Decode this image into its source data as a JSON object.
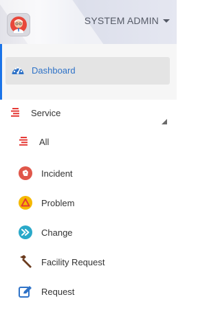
{
  "header": {
    "user_name": "SYSTEM ADMIN"
  },
  "nav": {
    "dashboard": "Dashboard",
    "service": "Service",
    "all": "All",
    "incident": "Incident",
    "problem": "Problem",
    "change": "Change",
    "facility_request": "Facility Request",
    "request": "Request"
  },
  "icons": {
    "dashboard": "speedometer-icon",
    "service": "list-icon",
    "all": "list-icon",
    "incident": "incident-icon",
    "problem": "warning-icon",
    "change": "fast-forward-icon",
    "facility_request": "hammer-icon",
    "request": "edit-icon"
  },
  "colors": {
    "active_accent": "#1a73e8",
    "active_label": "#2e72c7",
    "list_icon": "#e53935",
    "incident": "#e0574a",
    "problem": "#f5b800",
    "change": "#2aa9c9",
    "facility": "#6b3b1e",
    "request": "#2e72c7"
  }
}
